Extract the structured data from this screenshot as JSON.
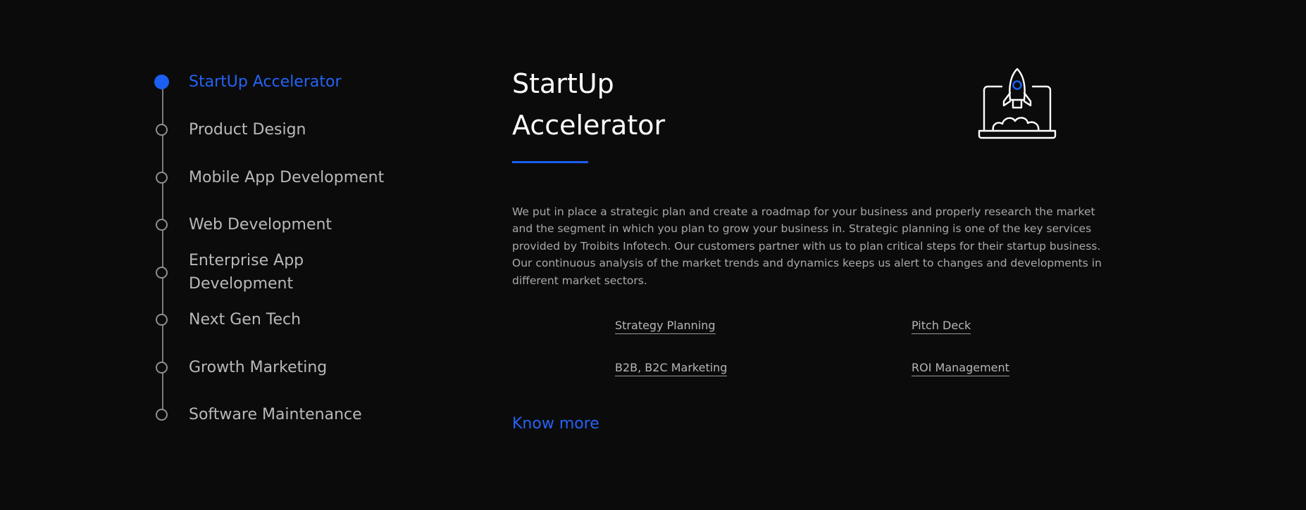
{
  "colors": {
    "background": "#0b0b0b",
    "accent": "#1c5ff0",
    "text": "#b9b9b9"
  },
  "nav": {
    "items": [
      {
        "label": "StartUp Accelerator",
        "active": true
      },
      {
        "label": "Product Design",
        "active": false
      },
      {
        "label": "Mobile App Development",
        "active": false
      },
      {
        "label": "Web Development",
        "active": false
      },
      {
        "label": "Enterprise App Development",
        "active": false
      },
      {
        "label": "Next Gen Tech",
        "active": false
      },
      {
        "label": "Growth Marketing",
        "active": false
      },
      {
        "label": "Software Maintenance",
        "active": false
      }
    ]
  },
  "content": {
    "title": "StartUp Accelerator",
    "description": "We put in place a strategic plan and create a roadmap for your business and properly research the market and the segment in which you plan to grow your business in. Strategic planning is one of the key services provided by Troibits Infotech. Our customers partner with us to plan critical steps for their startup business. Our continuous analysis of the market trends and dynamics keeps us alert to changes and developments in different market sectors.",
    "services": [
      "Strategy Planning",
      "Pitch Deck",
      "B2B, B2C Marketing",
      "ROI Management"
    ],
    "cta": "Know more",
    "illustration_icon": "rocket-laptop-icon"
  }
}
